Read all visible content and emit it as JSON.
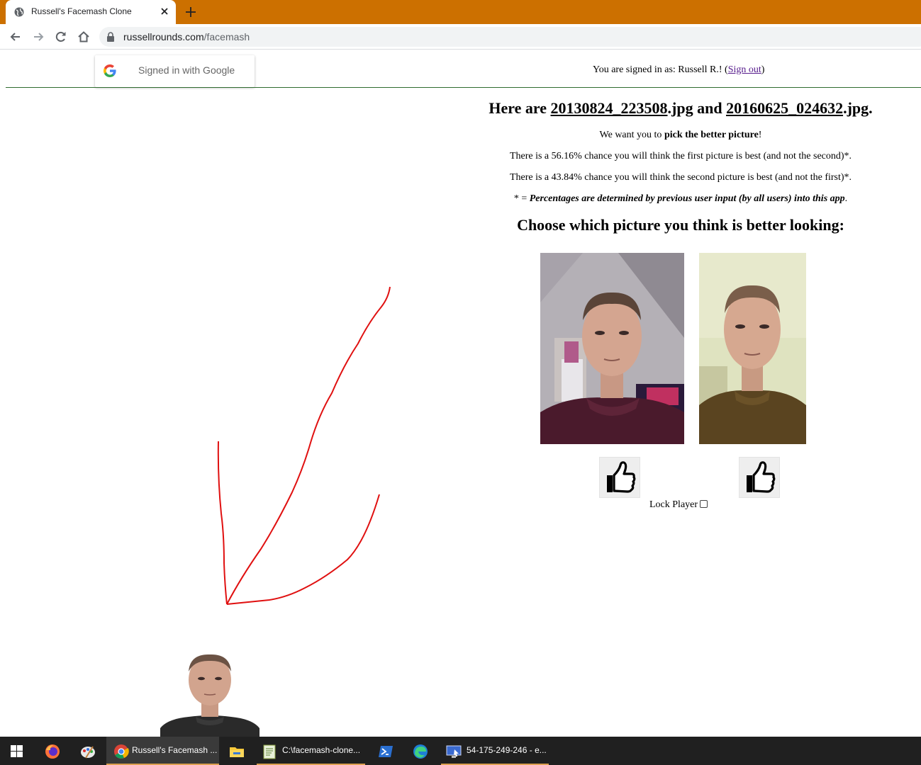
{
  "browser": {
    "tab_title": "Russell's Facemash Clone",
    "url_host": "russellrounds.com",
    "url_path": "/facemash",
    "tab_bar_color": "#cc7000"
  },
  "page": {
    "google_signin_label": "Signed in with Google",
    "signed_in_prefix": "You are signed in as: Russell R.! (",
    "sign_out_label": "Sign out",
    "signed_in_suffix": ")",
    "heading": {
      "prefix": "Here are ",
      "file1": "20130824_223508",
      "ext1": ".jpg",
      "middle": " and ",
      "file2": "20160625_024632",
      "ext2": ".jpg."
    },
    "intro": {
      "prefix": "We want you to ",
      "bold": "pick the better picture",
      "suffix": "!"
    },
    "chance_first": "There is a 56.16% chance you will think the first picture is best (and not the second)*.",
    "chance_second": "There is a 43.84% chance you will think the second picture is best (and not the first)*.",
    "note": {
      "prefix": "* = ",
      "emphasis": "Percentages are determined by previous user input (by all users) into this app",
      "suffix": "."
    },
    "choose_heading": "Choose which picture you think is better looking:",
    "lock_player_label": "Lock Player",
    "lock_player_checked": false,
    "annotation_color": "#e01010",
    "vote_icon": "thumbs-up-icon"
  },
  "taskbar": {
    "items": [
      {
        "icon": "windows-start-icon"
      },
      {
        "icon": "firefox-icon"
      },
      {
        "icon": "paint-icon"
      },
      {
        "icon": "chrome-icon",
        "label": "Russell's Facemash ..."
      },
      {
        "icon": "file-explorer-icon"
      },
      {
        "icon": "notepad-icon",
        "label": "C:\\facemash-clone..."
      },
      {
        "icon": "powershell-icon"
      },
      {
        "icon": "edge-icon"
      },
      {
        "icon": "remote-desktop-icon",
        "label": "54-175-249-246 - e..."
      }
    ]
  }
}
